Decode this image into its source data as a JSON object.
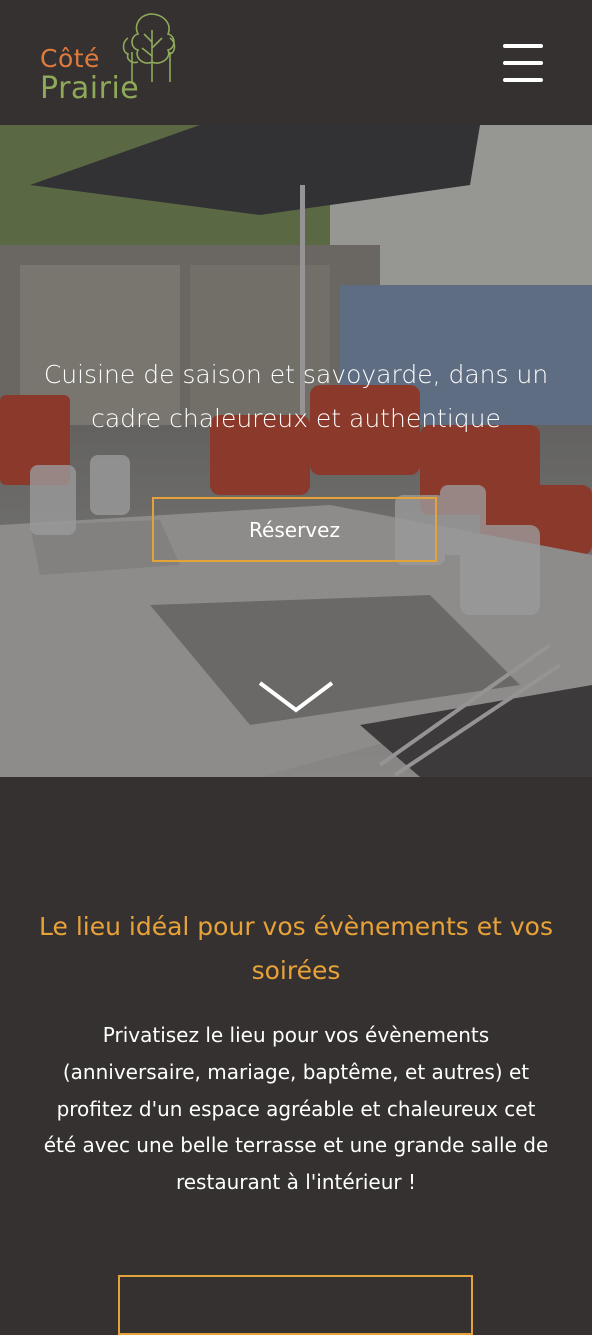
{
  "header": {
    "logo": {
      "line1": "Côté",
      "line2": "Prairie"
    },
    "menu_icon": "hamburger-menu-icon"
  },
  "hero": {
    "title": "Cuisine de saison et savoyarde, dans un cadre chaleureux et authentique",
    "reserve_label": "Réservez",
    "scroll_icon": "chevron-down-icon"
  },
  "events": {
    "title": "Le lieu idéal pour vos évènements et vos soirées",
    "text": "Privatisez le lieu pour vos évènements (anniversaire, mariage, baptême, et autres) et profitez d'un espace agréable et chaleureux cet été avec une belle terrasse et une grande salle de restaurant à l'intérieur !"
  },
  "colors": {
    "background": "#353130",
    "accent_orange": "#e8a238",
    "logo_orange": "#e07a3d",
    "logo_green": "#8fa95a",
    "text_white": "#ffffff"
  }
}
